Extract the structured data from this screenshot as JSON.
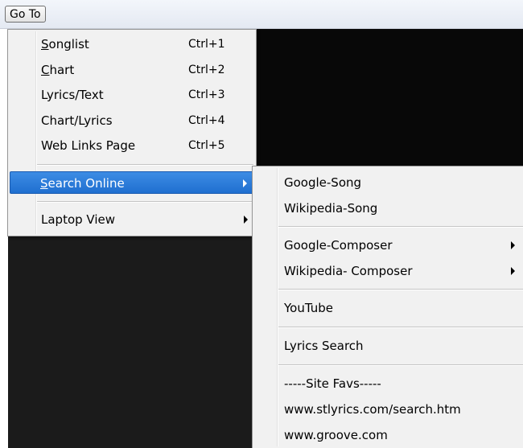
{
  "menubar": {
    "goto_label": "Go To"
  },
  "goto_menu": {
    "items": [
      {
        "label": "Songlist",
        "accel_letter": "S",
        "rest": "onglist",
        "shortcut": "Ctrl+1"
      },
      {
        "label": "Chart",
        "accel_letter": "C",
        "rest": "hart",
        "shortcut": "Ctrl+2"
      },
      {
        "label": "Lyrics/Text",
        "shortcut": "Ctrl+3"
      },
      {
        "label": "Chart/Lyrics",
        "shortcut": "Ctrl+4"
      },
      {
        "label": "Web Links Page",
        "shortcut": "Ctrl+5"
      },
      {
        "label": "Search Online",
        "accel_letter": "S",
        "rest": "earch Online",
        "has_submenu": true,
        "highlighted": true
      },
      {
        "label": "Laptop View",
        "has_submenu": true
      }
    ]
  },
  "search_submenu": {
    "items": [
      {
        "label": "Google-Song"
      },
      {
        "label": "Wikipedia-Song"
      },
      {
        "label": "Google-Composer",
        "has_submenu": true
      },
      {
        "label": "Wikipedia- Composer",
        "has_submenu": true
      },
      {
        "label": "YouTube"
      },
      {
        "label": "Lyrics Search"
      },
      {
        "label": "-----Site Favs-----"
      },
      {
        "label": "www.stlyrics.com/search.htm"
      },
      {
        "label": "www.groove.com"
      }
    ]
  },
  "colors": {
    "highlight": "#2a7ddb",
    "menu_bg": "#f1f1f1",
    "app_bg": "#080808"
  }
}
